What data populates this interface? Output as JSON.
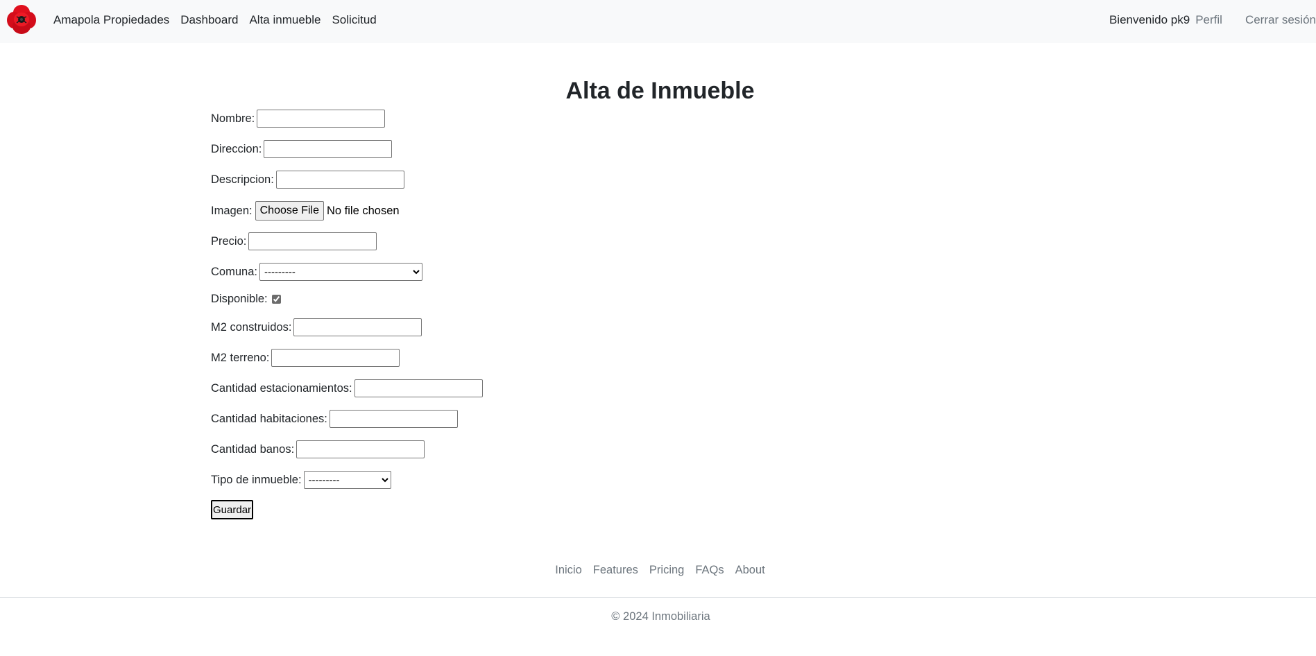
{
  "navbar": {
    "logo_icon": "poppy-flower-logo-icon",
    "brand": "Amapola Propiedades",
    "links": [
      "Dashboard",
      "Alta inmueble",
      "Solicitud"
    ],
    "welcome": "Bienvenido pk9",
    "profile": "Perfil",
    "logout": "Cerrar sesión"
  },
  "page": {
    "title": "Alta de Inmueble"
  },
  "form": {
    "nombre": {
      "label": "Nombre:",
      "value": ""
    },
    "direccion": {
      "label": "Direccion:",
      "value": ""
    },
    "descripcion": {
      "label": "Descripcion:",
      "value": ""
    },
    "imagen": {
      "label": "Imagen:",
      "button": "Choose File",
      "status": "No file chosen"
    },
    "precio": {
      "label": "Precio:",
      "value": ""
    },
    "comuna": {
      "label": "Comuna:",
      "selected": "---------"
    },
    "disponible": {
      "label": "Disponible:",
      "checked": true
    },
    "m2_construidos": {
      "label": "M2 construidos:",
      "value": ""
    },
    "m2_terreno": {
      "label": "M2 terreno:",
      "value": ""
    },
    "estacionamientos": {
      "label": "Cantidad estacionamientos:",
      "value": ""
    },
    "habitaciones": {
      "label": "Cantidad habitaciones:",
      "value": ""
    },
    "banos": {
      "label": "Cantidad banos:",
      "value": ""
    },
    "tipo": {
      "label": "Tipo de inmueble:",
      "selected": "---------"
    },
    "submit": "Guardar"
  },
  "footer": {
    "links": [
      "Inicio",
      "Features",
      "Pricing",
      "FAQs",
      "About"
    ],
    "copyright": "© 2024 Inmobiliaria"
  }
}
